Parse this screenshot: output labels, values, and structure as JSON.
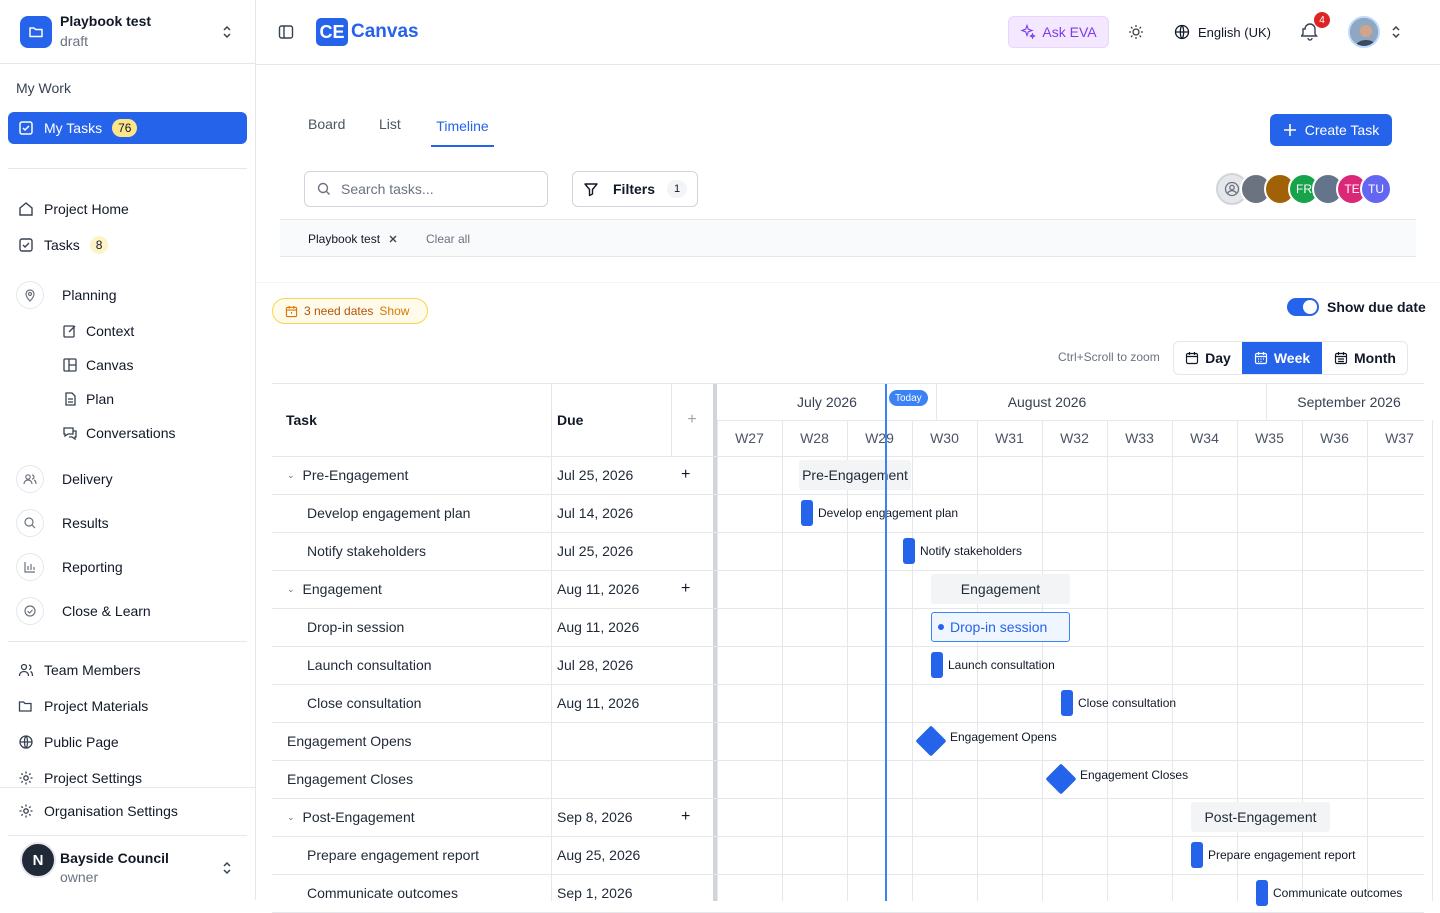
{
  "project": {
    "name": "Playbook test",
    "status": "draft"
  },
  "sidebar": {
    "my_work_label": "My Work",
    "my_tasks": {
      "label": "My Tasks",
      "count": "76"
    },
    "project_home": "Project Home",
    "tasks": {
      "label": "Tasks",
      "count": "8"
    },
    "planning": "Planning",
    "planning_items": [
      "Context",
      "Canvas",
      "Plan",
      "Conversations"
    ],
    "delivery": "Delivery",
    "results": "Results",
    "reporting": "Reporting",
    "close_learn": "Close & Learn",
    "team_members": "Team Members",
    "project_materials": "Project Materials",
    "public_page": "Public Page",
    "project_settings": "Project Settings",
    "organisation_settings": "Organisation Settings",
    "org": {
      "name": "Bayside Council",
      "role": "owner",
      "initial": "N"
    }
  },
  "topbar": {
    "logo_mark": "CE",
    "logo_text": "Canvas",
    "ask_eva": "Ask EVA",
    "language": "English (UK)",
    "notification_count": "4"
  },
  "views": {
    "tabs": [
      "Board",
      "List",
      "Timeline"
    ],
    "active": "Timeline"
  },
  "create_task": "Create Task",
  "search": {
    "placeholder": "Search tasks..."
  },
  "filters": {
    "label": "Filters",
    "count": "1"
  },
  "team_avatars": [
    {
      "initials": "",
      "color": "#e5e7eb"
    },
    {
      "initials": "",
      "color": "#6b7280"
    },
    {
      "initials": "",
      "color": "#a16207"
    },
    {
      "initials": "FR",
      "color": "#16a34a"
    },
    {
      "initials": "",
      "color": "#64748b"
    },
    {
      "initials": "TE",
      "color": "#db2777"
    },
    {
      "initials": "TU",
      "color": "#6366f1"
    }
  ],
  "filter_chip": "Playbook test",
  "clear_all": "Clear all",
  "need_dates": {
    "label": "3 need dates",
    "action": "Show"
  },
  "show_due_date": {
    "label": "Show due date",
    "on": true
  },
  "zoom_hint": "Ctrl+Scroll to zoom",
  "zoom": {
    "options": [
      "Day",
      "Week",
      "Month"
    ],
    "active": "Week"
  },
  "table": {
    "col_task": "Task",
    "col_due": "Due",
    "add": "+"
  },
  "timeline": {
    "months": [
      "July 2026",
      "August 2026",
      "September 2026"
    ],
    "weeks": [
      "W27",
      "W28",
      "W29",
      "W30",
      "W31",
      "W32",
      "W33",
      "W34",
      "W35",
      "W36",
      "W37"
    ],
    "today": "Today"
  },
  "rows": [
    {
      "task": "Pre-Engagement",
      "due": "Jul 25, 2026",
      "kind": "group"
    },
    {
      "task": "Develop engagement plan",
      "due": "Jul 14, 2026",
      "kind": "task"
    },
    {
      "task": "Notify stakeholders",
      "due": "Jul 25, 2026",
      "kind": "task"
    },
    {
      "task": "Engagement",
      "due": "Aug 11, 2026",
      "kind": "group"
    },
    {
      "task": "Drop-in session",
      "due": "Aug 11, 2026",
      "kind": "task"
    },
    {
      "task": "Launch consultation",
      "due": "Jul 28, 2026",
      "kind": "task"
    },
    {
      "task": "Close consultation",
      "due": "Aug 11, 2026",
      "kind": "task"
    },
    {
      "task": "Engagement Opens",
      "due": "",
      "kind": "milestone"
    },
    {
      "task": "Engagement Closes",
      "due": "",
      "kind": "milestone"
    },
    {
      "task": "Post-Engagement",
      "due": "Sep 8, 2026",
      "kind": "group"
    },
    {
      "task": "Prepare engagement report",
      "due": "Aug 25, 2026",
      "kind": "task"
    },
    {
      "task": "Communicate outcomes",
      "due": "Sep 1, 2026",
      "kind": "task"
    }
  ]
}
